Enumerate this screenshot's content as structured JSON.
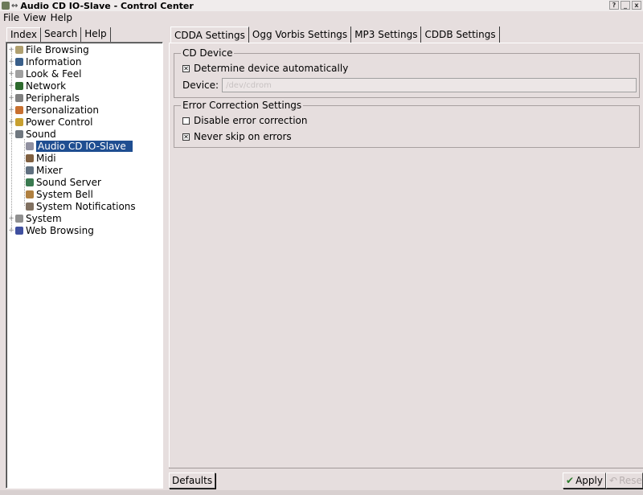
{
  "window": {
    "title": "Audio CD IO-Slave - Control Center",
    "pin_glyph": "↔"
  },
  "menu": {
    "items": [
      "File",
      "View",
      "Help"
    ]
  },
  "left_tabs": [
    {
      "label": "Index",
      "active": true
    },
    {
      "label": "Search",
      "active": false
    },
    {
      "label": "Help",
      "active": false
    }
  ],
  "tree": {
    "items": [
      {
        "label": "File Browsing",
        "icon": "folder-icon",
        "color": "#b0a070",
        "level": 0,
        "expander": "+"
      },
      {
        "label": "Information",
        "icon": "info-icon",
        "color": "#3a5f8a",
        "level": 0,
        "expander": "+"
      },
      {
        "label": "Look & Feel",
        "icon": "brush-icon",
        "color": "#a0a0a0",
        "level": 0,
        "expander": "+"
      },
      {
        "label": "Network",
        "icon": "globe-icon",
        "color": "#2d6a2d",
        "level": 0,
        "expander": "+"
      },
      {
        "label": "Peripherals",
        "icon": "mouse-icon",
        "color": "#808080",
        "level": 0,
        "expander": "+"
      },
      {
        "label": "Personalization",
        "icon": "person-icon",
        "color": "#c87030",
        "level": 0,
        "expander": "+"
      },
      {
        "label": "Power Control",
        "icon": "battery-icon",
        "color": "#c8a030",
        "level": 0,
        "expander": "+"
      },
      {
        "label": "Sound",
        "icon": "speaker-icon",
        "color": "#707880",
        "level": 0,
        "expander": "−"
      },
      {
        "label": "Audio CD IO-Slave",
        "icon": "cd-icon",
        "color": "#9090a0",
        "level": 1,
        "selected": true
      },
      {
        "label": "Midi",
        "icon": "keyboard-icon",
        "color": "#806040",
        "level": 1
      },
      {
        "label": "Mixer",
        "icon": "mixer-icon",
        "color": "#607080",
        "level": 1
      },
      {
        "label": "Sound Server",
        "icon": "server-icon",
        "color": "#3a7a50",
        "level": 1
      },
      {
        "label": "System Bell",
        "icon": "bell-icon",
        "color": "#b08040",
        "level": 1
      },
      {
        "label": "System Notifications",
        "icon": "notification-icon",
        "color": "#807060",
        "level": 1
      },
      {
        "label": "System",
        "icon": "wrench-icon",
        "color": "#909090",
        "level": 0,
        "expander": "+"
      },
      {
        "label": "Web Browsing",
        "icon": "web-icon",
        "color": "#4050a0",
        "level": 0,
        "expander": "+"
      }
    ]
  },
  "right_tabs": [
    {
      "label": "CDDA Settings",
      "active": true
    },
    {
      "label": "Ogg Vorbis Settings",
      "active": false
    },
    {
      "label": "MP3 Settings",
      "active": false
    },
    {
      "label": "CDDB Settings",
      "active": false
    }
  ],
  "cd_device": {
    "title": "CD Device",
    "auto_label": "Determine device automatically",
    "auto_checked": true,
    "device_label": "Device:",
    "device_value": "/dev/cdrom"
  },
  "error_correction": {
    "title": "Error Correction Settings",
    "disable_label": "Disable error correction",
    "disable_checked": false,
    "never_skip_label": "Never skip on errors",
    "never_skip_checked": true
  },
  "buttons": {
    "defaults": "Defaults",
    "apply": "Apply",
    "reset": "Reset"
  },
  "check_glyph": "✕",
  "apply_glyph": "✔",
  "reset_glyph": "↶"
}
